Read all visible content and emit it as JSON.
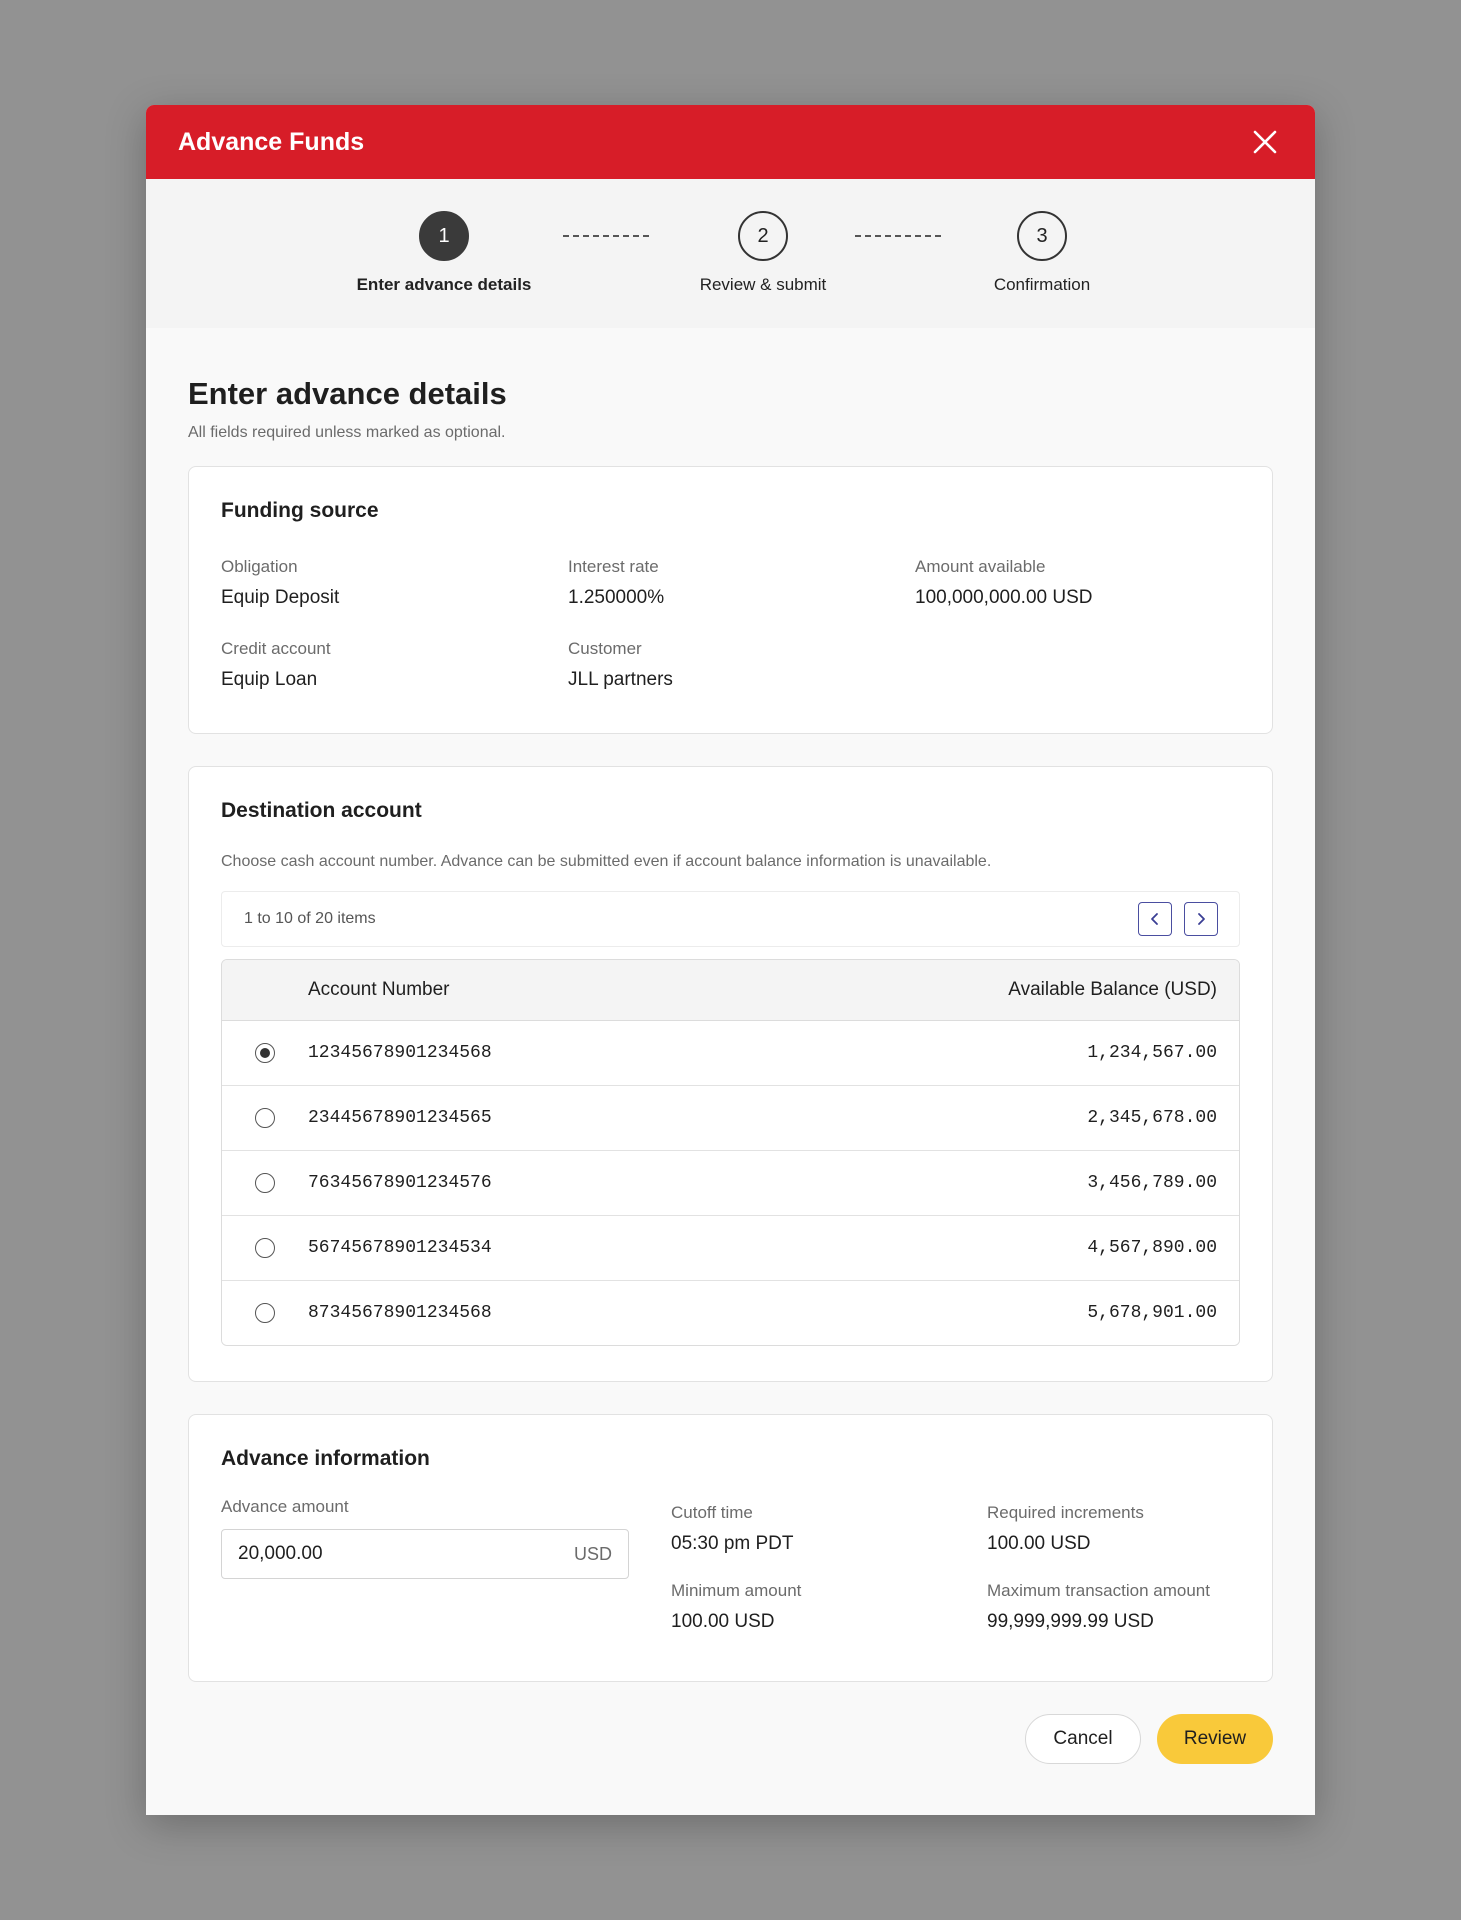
{
  "modal": {
    "title": "Advance Funds"
  },
  "stepper": {
    "steps": [
      {
        "number": "1",
        "label": "Enter advance details"
      },
      {
        "number": "2",
        "label": "Review & submit"
      },
      {
        "number": "3",
        "label": "Confirmation"
      }
    ],
    "active_step": 1
  },
  "page": {
    "title": "Enter advance details",
    "subtitle": "All fields required unless marked as optional."
  },
  "funding_source": {
    "title": "Funding source",
    "obligation_label": "Obligation",
    "obligation_value": "Equip Deposit",
    "interest_label": "Interest rate",
    "interest_value": "1.250000%",
    "available_label": "Amount available",
    "available_value": "100,000,000.00 USD",
    "credit_label": "Credit account",
    "credit_value": "Equip Loan",
    "customer_label": "Customer",
    "customer_value": "JLL partners"
  },
  "destination": {
    "title": "Destination account",
    "description": "Choose cash account number. Advance can be submitted even if account balance information is unavailable.",
    "pager_text": "1 to 10 of 20 items",
    "columns": {
      "account": "Account Number",
      "balance": "Available Balance (USD)"
    },
    "rows": [
      {
        "account": "12345678901234568",
        "balance": "1,234,567.00",
        "selected": true
      },
      {
        "account": "23445678901234565",
        "balance": "2,345,678.00",
        "selected": false
      },
      {
        "account": "76345678901234576",
        "balance": "3,456,789.00",
        "selected": false
      },
      {
        "account": "56745678901234534",
        "balance": "4,567,890.00",
        "selected": false
      },
      {
        "account": "87345678901234568",
        "balance": "5,678,901.00",
        "selected": false
      }
    ]
  },
  "advance_info": {
    "title": "Advance information",
    "amount_label": "Advance amount",
    "amount_value": "20,000.00",
    "amount_suffix": "USD",
    "cutoff_label": "Cutoff time",
    "cutoff_value": "05:30 pm PDT",
    "increments_label": "Required increments",
    "increments_value": "100.00 USD",
    "minimum_label": "Minimum amount",
    "minimum_value": "100.00 USD",
    "maximum_label": "Maximum transaction amount",
    "maximum_value": "99,999,999.99 USD"
  },
  "footer": {
    "cancel_label": "Cancel",
    "review_label": "Review"
  },
  "colors": {
    "header": "#d71d28",
    "primary_button": "#f9c93a",
    "active_step": "#3a3a3a",
    "pager_accent": "#4a4ea0"
  },
  "icons": {
    "close": "close-icon",
    "prev": "chevron-left-icon",
    "next": "chevron-right-icon"
  }
}
